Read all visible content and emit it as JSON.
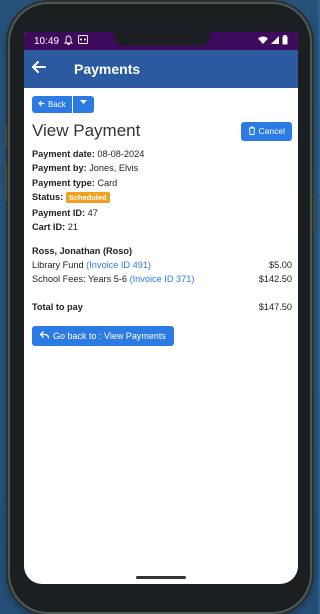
{
  "status_bar": {
    "time": "10:49",
    "left_icons": [
      "bell-icon",
      "cast-icon"
    ],
    "right_icons": [
      "wifi-icon",
      "signal-icon",
      "battery-icon"
    ]
  },
  "app_bar": {
    "title": "Payments",
    "back_icon": "arrow-left-icon"
  },
  "toolbar": {
    "back_label": "Back",
    "cancel_label": "Cancel"
  },
  "page": {
    "title": "View Payment"
  },
  "details": {
    "payment_date_label": "Payment date:",
    "payment_date_value": "08-08-2024",
    "payment_by_label": "Payment by:",
    "payment_by_value": "Jones, Elvis",
    "payment_type_label": "Payment type:",
    "payment_type_value": "Card",
    "status_label": "Status:",
    "status_value": "Scheduled",
    "status_color": "#f0a020",
    "payment_id_label": "Payment ID:",
    "payment_id_value": "47",
    "cart_id_label": "Cart ID:",
    "cart_id_value": "21"
  },
  "student": {
    "name": "Ross, Jonathan (Roso)"
  },
  "line_items": [
    {
      "description": "Library Fund",
      "link": "(Invoice ID 491)",
      "amount": "$5.00"
    },
    {
      "description": "School Fees: Years 5-6",
      "link": "(Invoice ID 371)",
      "amount": "$142.50"
    }
  ],
  "total": {
    "label": "Total to pay",
    "amount": "$147.50"
  },
  "go_back": {
    "label": "Go back to : View Payments"
  },
  "colors": {
    "accent": "#2c7be5",
    "app_bar": "#2c5aa0",
    "status_bar": "#3d0a5c",
    "background": "#2f5f8a"
  }
}
